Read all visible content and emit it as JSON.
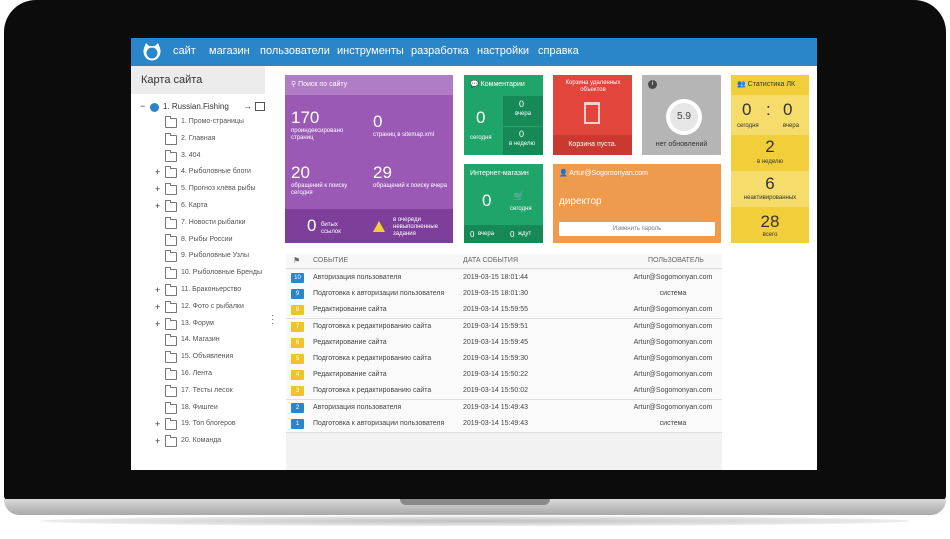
{
  "nav": {
    "items": [
      "сайт",
      "магазин",
      "пользователи",
      "инструменты",
      "разработка",
      "настройки",
      "справка"
    ]
  },
  "sidebar": {
    "title": "Карта сайта",
    "root": "1. Russian.Fishing",
    "items": [
      {
        "label": "1. Промо-страницы",
        "expandable": false
      },
      {
        "label": "2. Главная",
        "expandable": false
      },
      {
        "label": "3. 404",
        "expandable": false
      },
      {
        "label": "4. Рыболовные блоги",
        "expandable": true
      },
      {
        "label": "5. Прогноз клёва рыбы",
        "expandable": true
      },
      {
        "label": "6. Карта",
        "expandable": true
      },
      {
        "label": "7. Новости рыбалки",
        "expandable": false
      },
      {
        "label": "8. Рыбы России",
        "expandable": false
      },
      {
        "label": "9. Рыболовные Узлы",
        "expandable": false
      },
      {
        "label": "10. Рыболовные Бренды",
        "expandable": false
      },
      {
        "label": "11. Браконьерство",
        "expandable": true
      },
      {
        "label": "12. Фото с рыбалки",
        "expandable": true
      },
      {
        "label": "13. Форум",
        "expandable": true
      },
      {
        "label": "14. Магазин",
        "expandable": false
      },
      {
        "label": "15. Объявления",
        "expandable": false
      },
      {
        "label": "16. Лента",
        "expandable": false
      },
      {
        "label": "17. Тесты лесок",
        "expandable": false
      },
      {
        "label": "18. Фишгеи",
        "expandable": false
      },
      {
        "label": "19. Топ блогеров",
        "expandable": true
      },
      {
        "label": "20. Команда",
        "expandable": true
      }
    ]
  },
  "tiles": {
    "search": {
      "title": "Поиск по сайту",
      "indexed_value": "170",
      "indexed_label": "проиндексировано страниц",
      "sitemap_value": "0",
      "sitemap_label": "страниц в sitemap.xml",
      "today_value": "20",
      "today_label": "обращений к поиску сегодня",
      "yesterday_value": "29",
      "yesterday_label": "обращений к поиску вчера",
      "broken_value": "0",
      "broken_label": "битых ссылок",
      "queue_label": "в очереди невыполненные задания"
    },
    "comments": {
      "title": "Комментарии",
      "today_value": "0",
      "today_label": "сегодня",
      "yesterday_value": "0",
      "yesterday_label": "вчера",
      "week_value": "0",
      "week_label": "в неделю"
    },
    "trash": {
      "title": "Корзина удаленных объектов",
      "status": "Корзина пуста."
    },
    "updates": {
      "version": "5.9",
      "label": "нет обновлений"
    },
    "stats": {
      "title": "Статистика ЛК",
      "today_value": "0",
      "today_label": "сегодня",
      "yesterday_value": "0",
      "yesterday_label": "вчера",
      "week_value": "2",
      "week_label": "в неделю",
      "inactive_value": "6",
      "inactive_label": "неактивированных",
      "total_value": "28",
      "total_label": "всего"
    },
    "shop": {
      "title": "Интернет-магазин",
      "today_value": "0",
      "today_label": "сегодня",
      "yesterday_value": "0",
      "yesterday_label": "вчера",
      "waiting_value": "0",
      "waiting_label": "ждут"
    },
    "user": {
      "email": "Artur@Sogomonyan.com",
      "role": "директор",
      "change_password": "Изменить пароль"
    }
  },
  "log": {
    "headers": {
      "event": "СОБЫТИЕ",
      "date": "ДАТА СОБЫТИЯ",
      "user": "ПОЛЬЗОВАТЕЛЬ"
    },
    "rows": [
      {
        "n": "10",
        "event": "Авторизация пользователя",
        "date": "2019-03-15 18:01:44",
        "user": "Artur@Sogomonyan.com",
        "color": "#2a86c9"
      },
      {
        "n": "9",
        "event": "Подготовка к авторизации пользователя",
        "date": "2019-03-15 18:01:30",
        "user": "система",
        "color": "#2a86c9"
      },
      {
        "n": "8",
        "event": "Редактирование сайта",
        "date": "2019-03-14 15:59:55",
        "user": "Artur@Sogomonyan.com",
        "color": "#f0c22e"
      },
      {
        "n": "7",
        "event": "Подготовка к редактированию сайта",
        "date": "2019-03-14 15:59:51",
        "user": "Artur@Sogomonyan.com",
        "color": "#f0c22e"
      },
      {
        "n": "6",
        "event": "Редактирование сайта",
        "date": "2019-03-14 15:59:45",
        "user": "Artur@Sogomonyan.com",
        "color": "#f0c22e"
      },
      {
        "n": "5",
        "event": "Подготовка к редактированию сайта",
        "date": "2019-03-14 15:59:30",
        "user": "Artur@Sogomonyan.com",
        "color": "#f0c22e"
      },
      {
        "n": "4",
        "event": "Редактирование сайта",
        "date": "2019-03-14 15:50:22",
        "user": "Artur@Sogomonyan.com",
        "color": "#f0c22e"
      },
      {
        "n": "3",
        "event": "Подготовка к редактированию сайта",
        "date": "2019-03-14 15:50:02",
        "user": "Artur@Sogomonyan.com",
        "color": "#f0c22e"
      },
      {
        "n": "2",
        "event": "Авторизация пользователя",
        "date": "2019-03-14 15:49:43",
        "user": "Artur@Sogomonyan.com",
        "color": "#2a86c9"
      },
      {
        "n": "1",
        "event": "Подготовка к авторизации пользователя",
        "date": "2019-03-14 15:49:43",
        "user": "система",
        "color": "#2a86c9"
      }
    ]
  },
  "colors": {
    "nav": "#2a86c9",
    "search": "#9b59b6",
    "comments": "#1fa56a",
    "trash": "#e2453c",
    "updates": "#b5b5b5",
    "stats": "#f2cf3a",
    "shop": "#1fa56a",
    "user": "#ef9b4e"
  }
}
